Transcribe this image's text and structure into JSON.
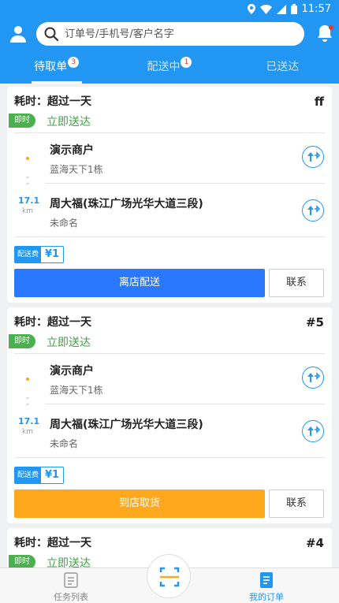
{
  "status": {
    "time": "11:57"
  },
  "search": {
    "placeholder": "订单号/手机号/客户名字"
  },
  "tabs": [
    {
      "label": "待取单",
      "badge": "3"
    },
    {
      "label": "配送中",
      "badge": "1"
    },
    {
      "label": "已送达",
      "badge": ""
    }
  ],
  "orders": [
    {
      "time_label": "耗时：超过一天",
      "number": "ff",
      "instant_tag": "即时",
      "instant_text": "立即送达",
      "pickup_name": "演示商户",
      "pickup_addr": "蓝海天下1栋",
      "distance": "17.1",
      "distance_unit": "km",
      "dropoff_name": "周大福(珠江广场光华大道三段)",
      "dropoff_addr": "未命名",
      "fee_label": "配送费",
      "fee": "¥1",
      "action": "离店配送",
      "contact": "联系"
    },
    {
      "time_label": "耗时：超过一天",
      "number": "#5",
      "instant_tag": "即时",
      "instant_text": "立即送达",
      "pickup_name": "演示商户",
      "pickup_addr": "蓝海天下1栋",
      "distance": "17.1",
      "distance_unit": "km",
      "dropoff_name": "周大福(珠江广场光华大道三段)",
      "dropoff_addr": "未命名",
      "fee_label": "配送费",
      "fee": "¥1",
      "action": "到店取货",
      "contact": "联系"
    },
    {
      "time_label": "耗时：超过一天",
      "number": "#4",
      "instant_tag": "即时",
      "instant_text": "立即送达"
    }
  ],
  "bottom_nav": [
    {
      "label": "任务列表"
    },
    {
      "label": "我的订单"
    }
  ],
  "colors": {
    "primary": "#2196f3",
    "action_blue": "#2979ff",
    "action_orange": "#ffa81c",
    "instant_green": "#4caf50"
  }
}
